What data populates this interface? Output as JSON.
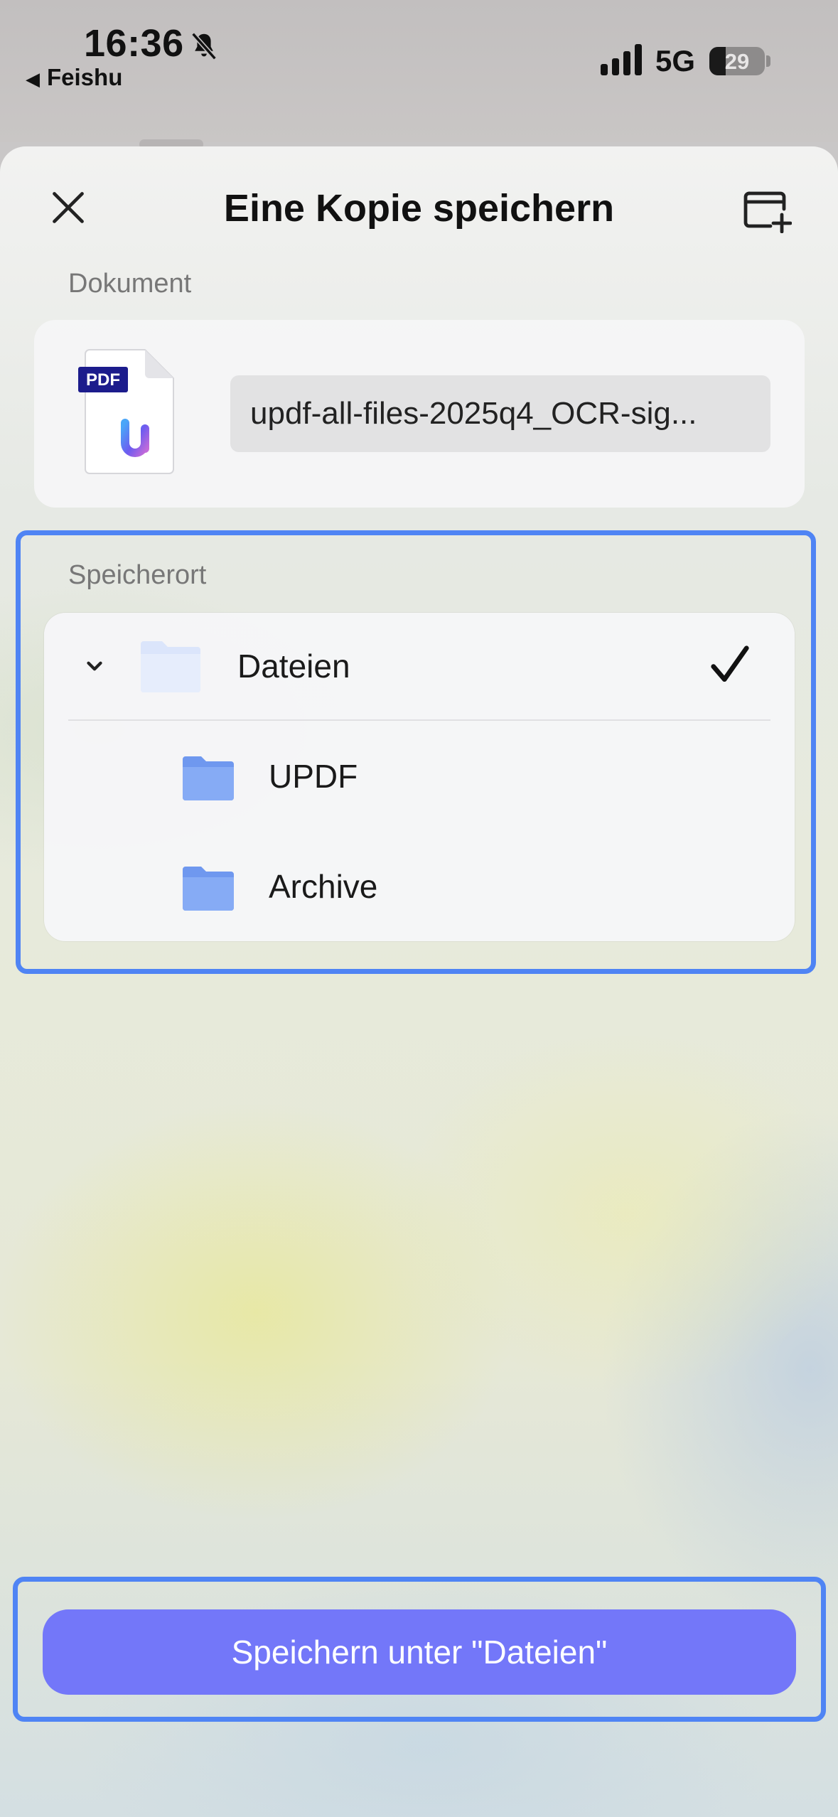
{
  "status_bar": {
    "time": "16:36",
    "back_app": "Feishu",
    "network": "5G",
    "battery": "29",
    "battery_level": 0.29
  },
  "sheet": {
    "title": "Eine Kopie speichern"
  },
  "document_section": {
    "label": "Dokument",
    "file_badge": "PDF",
    "file_name": "updf-all-files-2025q4_OCR-sig..."
  },
  "location_section": {
    "label": "Speicherort",
    "root_folder": {
      "name": "Dateien",
      "selected": true,
      "expanded": true
    },
    "subfolders": [
      {
        "name": "UPDF"
      },
      {
        "name": "Archive"
      }
    ]
  },
  "save_button": {
    "label": "Speichern unter \"Dateien\""
  },
  "colors": {
    "accent": "#7377f9",
    "highlight": "#4f84f4",
    "folder": "#7aa6f5"
  }
}
